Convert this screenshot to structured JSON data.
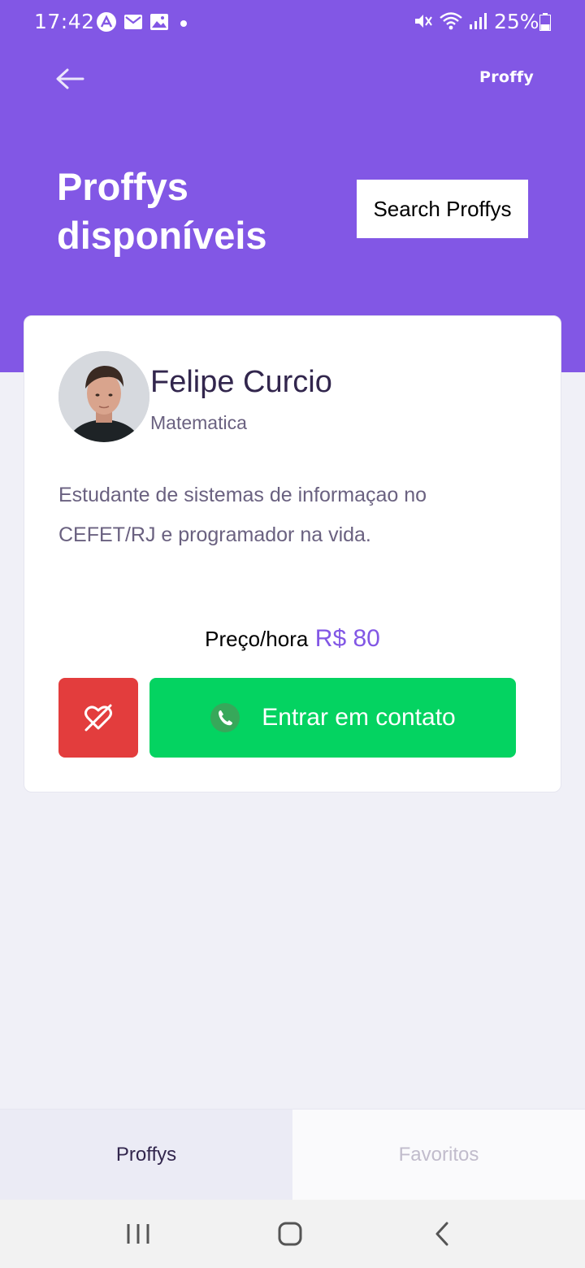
{
  "status_bar": {
    "time": "17:42",
    "battery": "25%"
  },
  "header": {
    "brand": "Proffy",
    "title": "Proffys disponíveis",
    "search_button": "Search Proffys"
  },
  "teacher_card": {
    "name": "Felipe Curcio",
    "subject": "Matematica",
    "bio": "Estudante de sistemas de informaçao no CEFET/RJ e programador na vida.",
    "price_label": "Preço/hora",
    "price_value": "R$ 80",
    "contact_button": "Entrar em contato"
  },
  "tabs": [
    {
      "label": "Proffys",
      "active": true
    },
    {
      "label": "Favoritos",
      "active": false
    }
  ],
  "colors": {
    "primary": "#8257E5",
    "secondary": "#04D361",
    "danger": "#E33D3D",
    "background": "#F0F0F7"
  },
  "icons": {
    "back": "arrow-left-icon",
    "unfavorite": "heart-off-icon",
    "whatsapp": "whatsapp-icon"
  }
}
